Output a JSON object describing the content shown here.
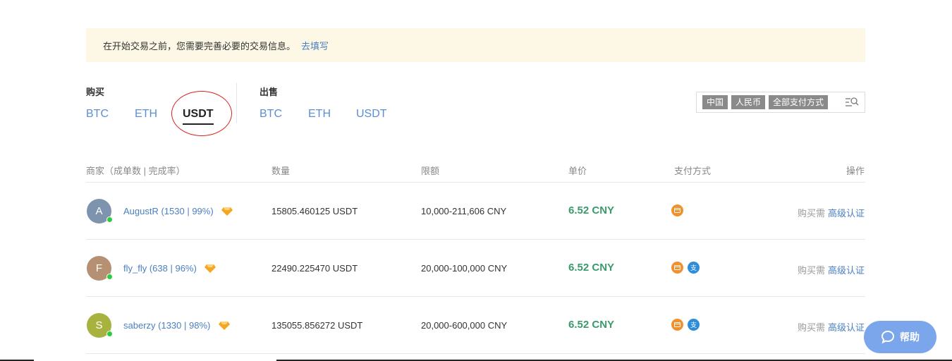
{
  "notice": {
    "text": "在开始交易之前，您需要完善必要的交易信息。",
    "link": "去填写"
  },
  "buy": {
    "label": "购买",
    "tabs": [
      "BTC",
      "ETH",
      "USDT"
    ],
    "active": "USDT"
  },
  "sell": {
    "label": "出售",
    "tabs": [
      "BTC",
      "ETH",
      "USDT"
    ]
  },
  "filters": {
    "country": "中国",
    "currency": "人民币",
    "payment": "全部支付方式",
    "icon": "filter-search-icon"
  },
  "table": {
    "headers": {
      "merchant": "商家（成单数 | 完成率）",
      "quantity": "数量",
      "limit": "限额",
      "price": "单价",
      "payment": "支付方式",
      "action": "操作"
    },
    "rows": [
      {
        "avatar": "A",
        "avatar_color": "#7d93ae",
        "merchant": "AugustR (1530 | 99%)",
        "quantity": "15805.460125 USDT",
        "limit": "10,000-211,606 CNY",
        "price": "6.52 CNY",
        "payments": [
          "bank-card-icon"
        ],
        "action_prefix": "购买需",
        "action_link": "高级认证"
      },
      {
        "avatar": "F",
        "avatar_color": "#b59072",
        "merchant": "fly_fly (638 | 96%)",
        "quantity": "22490.225470 USDT",
        "limit": "20,000-100,000 CNY",
        "price": "6.52 CNY",
        "payments": [
          "bank-card-icon",
          "alipay-icon"
        ],
        "action_prefix": "购买需",
        "action_link": "高级认证"
      },
      {
        "avatar": "S",
        "avatar_color": "#a7b33e",
        "merchant": "saberzy (1330 | 98%)",
        "quantity": "135055.856272 USDT",
        "limit": "20,000-600,000 CNY",
        "price": "6.52 CNY",
        "payments": [
          "bank-card-icon",
          "alipay-icon"
        ],
        "action_prefix": "购买需",
        "action_link": "高级认证"
      }
    ]
  },
  "help": {
    "label": "帮助"
  },
  "colors": {
    "link": "#4a7fc1",
    "price": "#3a9a6b",
    "notice_bg": "#fdf8e6",
    "help_bg": "#7ba6ec",
    "annotation": "#d9231c"
  }
}
